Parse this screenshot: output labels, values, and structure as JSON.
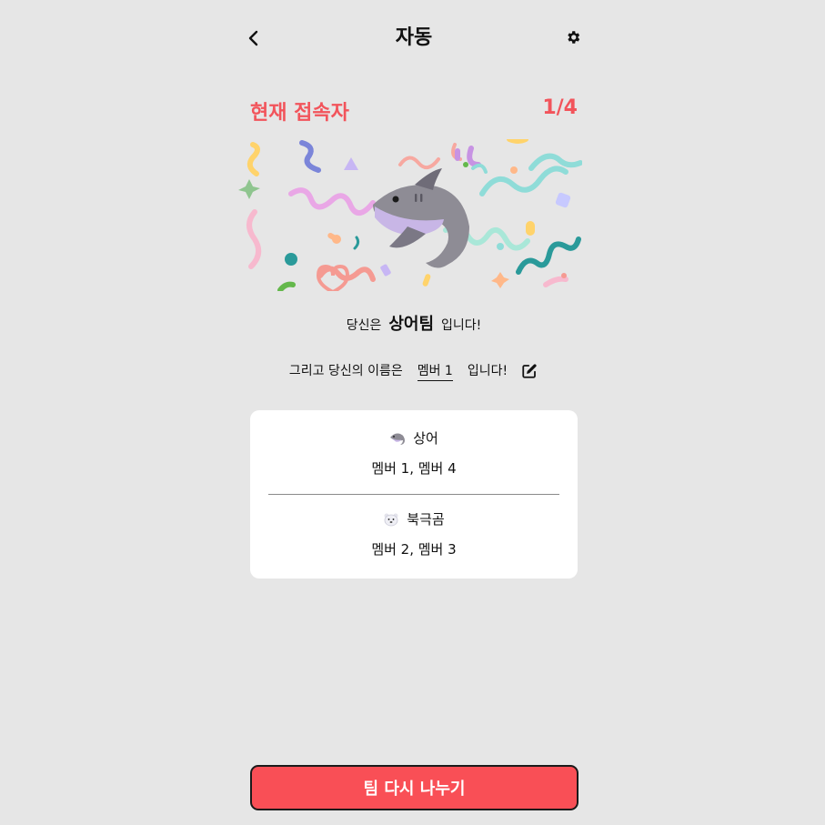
{
  "header": {
    "title": "자동",
    "back_icon": "chevron-left-icon",
    "settings_icon": "gear-icon"
  },
  "status": {
    "label": "현재 접속자",
    "count": "1/4",
    "color": "#f2545b"
  },
  "banner": {
    "icon": "shark-icon"
  },
  "team_line": {
    "prefix": "당신은",
    "team_name": "상어팀",
    "suffix": "입니다!"
  },
  "name_line": {
    "prefix": "그리고 당신의 이름은",
    "member_name": "멤버 1",
    "suffix": "입니다!",
    "edit_icon": "edit-icon"
  },
  "teams": [
    {
      "icon": "shark-icon",
      "name": "상어",
      "members": "멤버 1, 멤버 4"
    },
    {
      "icon": "polar-bear-icon",
      "name": "북극곰",
      "members": "멤버 2, 멤버 3"
    }
  ],
  "action": {
    "label": "팀 다시 나누기",
    "color": "#f94f56"
  }
}
